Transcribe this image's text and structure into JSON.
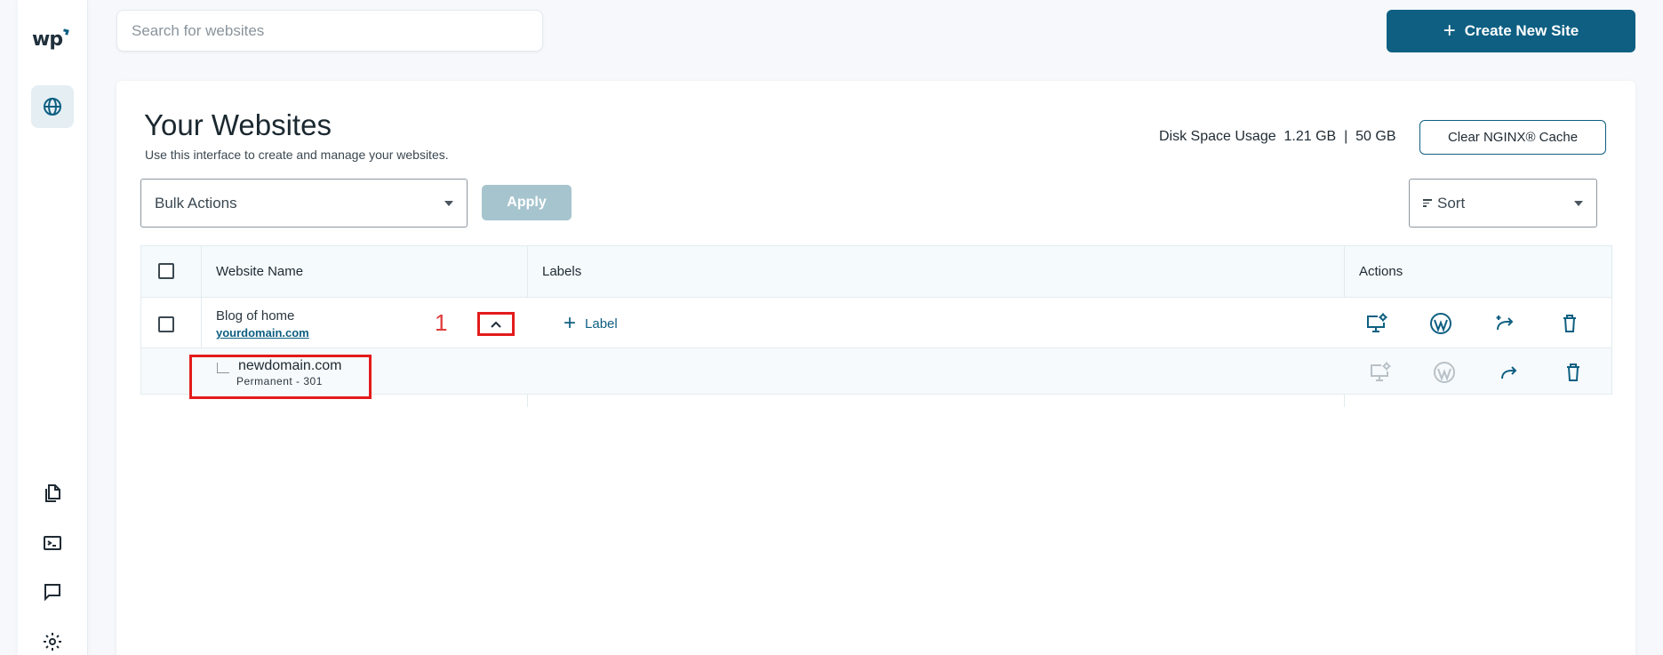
{
  "sidebar": {
    "logo_text": "wp",
    "nav": [
      {
        "name": "websites",
        "icon": "globe-icon",
        "active": true
      },
      {
        "name": "files",
        "icon": "files-icon"
      },
      {
        "name": "terminal",
        "icon": "terminal-icon"
      },
      {
        "name": "support",
        "icon": "chat-icon"
      },
      {
        "name": "settings",
        "icon": "gear-icon"
      }
    ]
  },
  "search": {
    "placeholder": "Search for websites"
  },
  "header": {
    "create_label": "Create New Site"
  },
  "page": {
    "title": "Your Websites",
    "subtitle": "Use this interface to create and manage your websites.",
    "disk_usage": "Disk Space Usage  1.21 GB  |  50 GB",
    "clear_cache_label": "Clear NGINX® Cache"
  },
  "toolbar": {
    "bulk_actions": "Bulk Actions",
    "apply_label": "Apply",
    "sort_label": "Sort"
  },
  "table": {
    "columns": [
      "Website Name",
      "Labels",
      "Actions"
    ],
    "rows": [
      {
        "name": "Blog of home",
        "domain": "yourdomain.com",
        "annotation": "1",
        "label_button": "Label",
        "redirect": {
          "domain": "newdomain.com",
          "type": "Permanent - 301"
        }
      }
    ]
  },
  "colors": {
    "brand": "#0e5f82",
    "highlight": "#e31b1b",
    "apply_disabled": "#a6c4ce"
  }
}
